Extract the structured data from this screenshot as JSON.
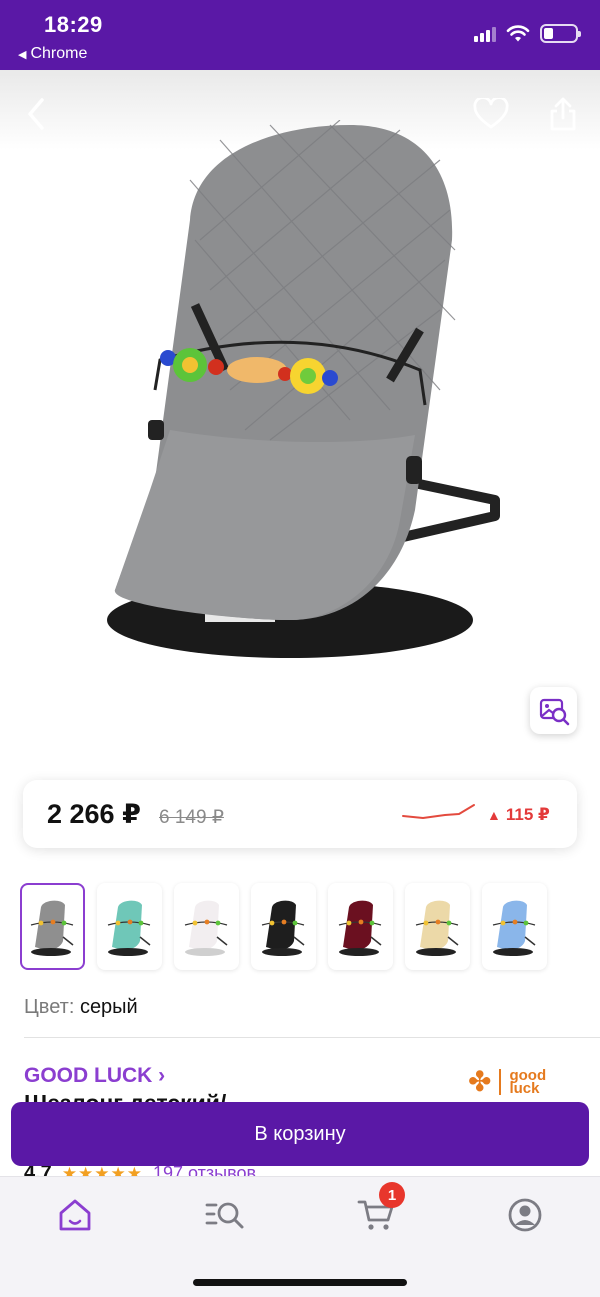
{
  "status_bar": {
    "time": "18:29",
    "back_app": "Chrome"
  },
  "icons": {
    "back": "chevron-left-icon",
    "favorite": "heart-icon",
    "share": "share-icon",
    "image_search": "image-search-icon",
    "home": "home-icon",
    "catalog": "catalog-search-icon",
    "cart": "cart-icon",
    "profile": "profile-icon"
  },
  "price": {
    "current": "2 266 ₽",
    "old": "6 149 ₽",
    "delta": "115 ₽",
    "delta_color": "#e33a3a"
  },
  "thumbnails": [
    {
      "color": "#8f8f8f",
      "base": "#222"
    },
    {
      "color": "#6fc7b8",
      "base": "#222"
    },
    {
      "color": "#f2eef0",
      "base": "#cfcfcf"
    },
    {
      "color": "#1e1e1e",
      "base": "#222"
    },
    {
      "color": "#6b1020",
      "base": "#222"
    },
    {
      "color": "#ecd9a8",
      "base": "#222"
    },
    {
      "color": "#8ab6ea",
      "base": "#222"
    }
  ],
  "color": {
    "label": "Цвет:",
    "value": "серый"
  },
  "brand": {
    "name": "GOOD LUCK ›",
    "logo_text_1": "good",
    "logo_text_2": "luck"
  },
  "product": {
    "title": "Шезлонг детский/"
  },
  "rating": {
    "score": "4.7",
    "stars": "★★★★★",
    "reviews": "197 отзывов"
  },
  "cart_button": {
    "label": "В корзину"
  },
  "tabbar": {
    "cart_count": "1"
  },
  "colors": {
    "brand": "#5a18a6",
    "accent": "#8b3ed0"
  }
}
